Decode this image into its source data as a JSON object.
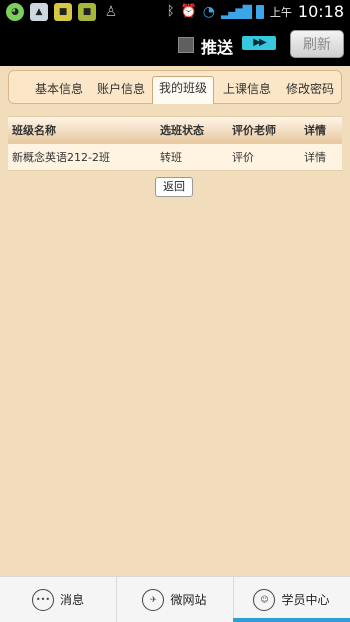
{
  "status_bar": {
    "left_icons": [
      "app-icon-green",
      "gallery-icon",
      "app-icon-yellow",
      "app-icon-yellow-2",
      "qq-icon"
    ],
    "ampm": "上午",
    "time": "10:18"
  },
  "app_bar": {
    "push_label": "推送",
    "refresh_label": "刷新"
  },
  "tabs": [
    {
      "label": "基本信息"
    },
    {
      "label": "账户信息"
    },
    {
      "label": "我的班级"
    },
    {
      "label": "上课信息"
    },
    {
      "label": "修改密码"
    }
  ],
  "active_tab": "我的班级",
  "table": {
    "headers": [
      "班级名称",
      "选班状态",
      "评价老师",
      "详情"
    ],
    "rows": [
      [
        "新概念英语212-2班",
        "转班",
        "评价",
        "详情"
      ]
    ]
  },
  "back_label": "返回",
  "bottom_nav": [
    {
      "label": "消息",
      "icon": "message-icon"
    },
    {
      "label": "微网站",
      "icon": "microsite-icon"
    },
    {
      "label": "学员中心",
      "icon": "student-center-icon"
    }
  ],
  "colors": {
    "background": "#f1dcbc",
    "accent": "#2aa0d8",
    "push_toggle": "#36c9dc"
  }
}
